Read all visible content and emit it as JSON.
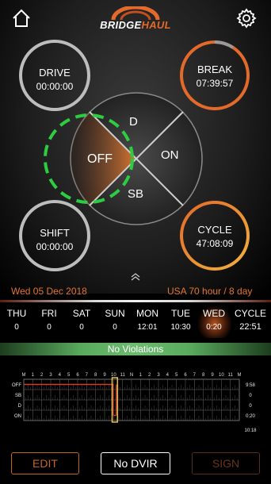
{
  "header": {
    "logo_text_main": "BRIDGE",
    "logo_text_accent": "HAUL",
    "home_icon": "home-icon",
    "settings_icon": "gear-icon"
  },
  "gauges": {
    "drive": {
      "label": "DRIVE",
      "value": "00:00:00"
    },
    "break": {
      "label": "BREAK",
      "value": "07:39:57"
    },
    "shift": {
      "label": "SHIFT",
      "value": "00:00:00"
    },
    "cycle": {
      "label": "CYCLE",
      "value": "47:08:09"
    }
  },
  "status_wheel": {
    "off": "OFF",
    "on": "ON",
    "d": "D",
    "sb": "SB",
    "active": "OFF"
  },
  "date": "Wed 05 Dec 2018",
  "rule": "USA 70 hour / 8 day",
  "recap": {
    "days": [
      {
        "name": "THU",
        "value": "0"
      },
      {
        "name": "FRI",
        "value": "0"
      },
      {
        "name": "SAT",
        "value": "0"
      },
      {
        "name": "SUN",
        "value": "0"
      },
      {
        "name": "MON",
        "value": "12:01"
      },
      {
        "name": "TUE",
        "value": "10:30"
      },
      {
        "name": "WED",
        "value": "0:20"
      }
    ],
    "cycle_label": "CYCLE",
    "cycle_value": "22:51"
  },
  "violations": "No Violations",
  "log_grid": {
    "hour_labels": [
      "M",
      "1",
      "2",
      "3",
      "4",
      "5",
      "6",
      "7",
      "8",
      "9",
      "10",
      "11",
      "N",
      "1",
      "2",
      "3",
      "4",
      "5",
      "6",
      "7",
      "8",
      "9",
      "10",
      "11",
      "M"
    ],
    "rows": [
      "OFF",
      "SB",
      "D",
      "ON"
    ],
    "row_totals": [
      "9:58",
      "0",
      "0",
      "0:20"
    ],
    "total": "10:18"
  },
  "buttons": {
    "edit": "EDIT",
    "dvir": "No DVIR",
    "sign": "SIGN"
  },
  "colors": {
    "accent": "#e36a2a",
    "gauge_ring": "#bdbdbd",
    "dashed_ring": "#2ecc40",
    "violation_green": "#6cbb6f"
  }
}
